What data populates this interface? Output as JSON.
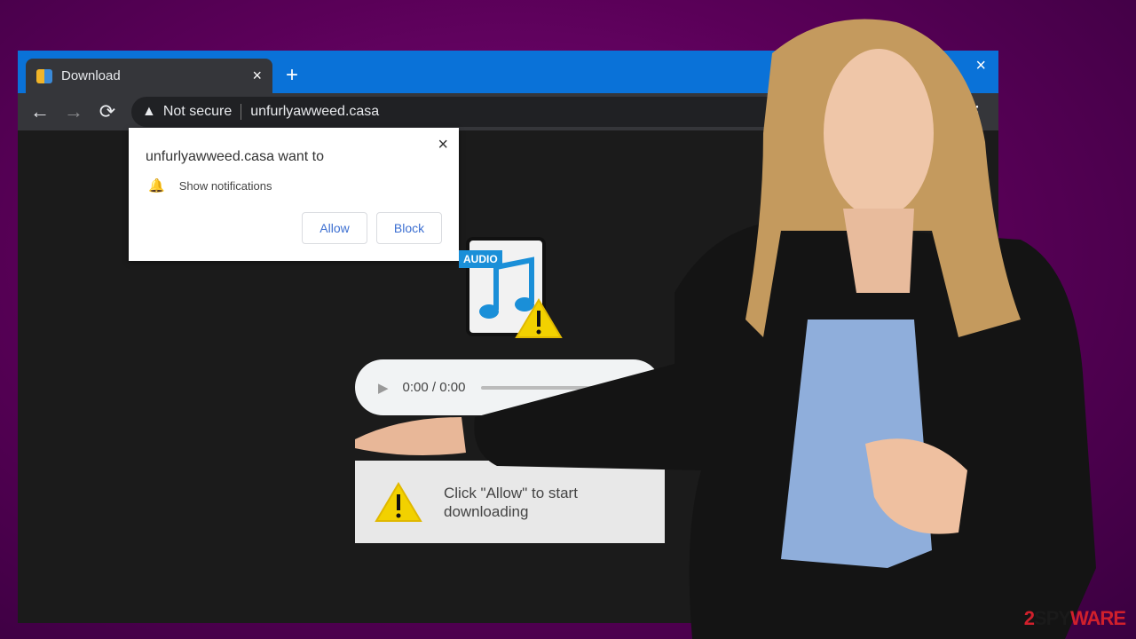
{
  "browser": {
    "tab_title": "Download",
    "new_tab": "+",
    "close_tab": "×",
    "close_window": "×",
    "not_secure": "Not secure",
    "url": "unfurlyawweed.casa",
    "menu": "⋮"
  },
  "popup": {
    "title": "unfurlyawweed.casa want to",
    "permission": "Show notifications",
    "allow": "Allow",
    "block": "Block",
    "close": "×"
  },
  "page": {
    "audio_label": "AUDIO",
    "time": "0:00 / 0:00",
    "notice": "Click \"Allow\" to start downloading"
  },
  "watermark": {
    "a": "2",
    "b": "SPY",
    "c": "WAR",
    "d": "E"
  },
  "colors": {
    "tabbar": "#0a72d8",
    "background": "#5a0058",
    "accent": "#3c6fd1"
  }
}
